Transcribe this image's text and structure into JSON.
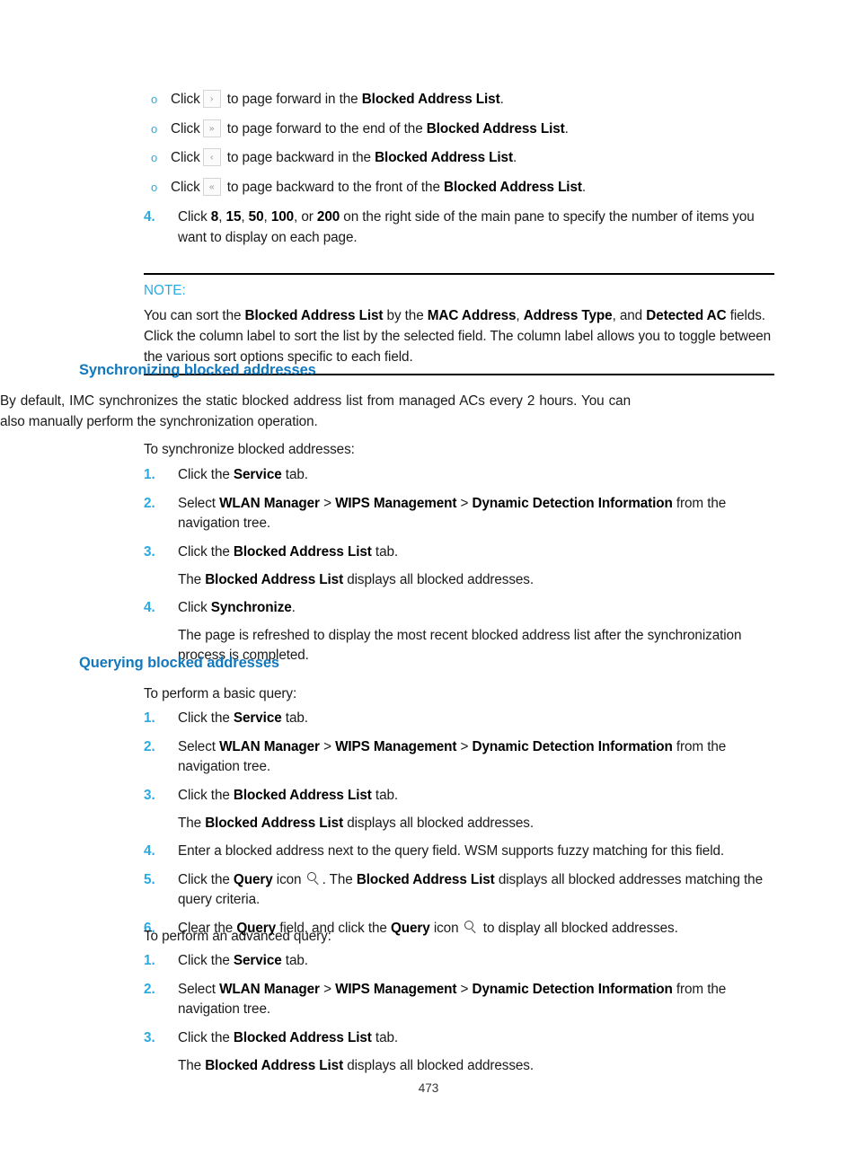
{
  "document": {
    "page_number": "473"
  },
  "paging_bullets": {
    "marker": "o",
    "items": [
      {
        "click": "Click",
        "icon_glyph": "›",
        "icon_name": "page-forward-icon",
        "text_before": " to page forward in the ",
        "bold_term": "Blocked Address List",
        "text_after": "."
      },
      {
        "click": "Click",
        "icon_glyph": "»",
        "icon_name": "page-last-icon",
        "text_before": " to page forward to the end of the ",
        "bold_term": "Blocked Address List",
        "text_after": "."
      },
      {
        "click": "Click",
        "icon_glyph": "‹",
        "icon_name": "page-backward-icon",
        "text_before": " to page backward in the ",
        "bold_term": "Blocked Address List",
        "text_after": "."
      },
      {
        "click": "Click",
        "icon_glyph": "«",
        "icon_name": "page-first-icon",
        "text_before": " to page backward to the front of the ",
        "bold_term": "Blocked Address List",
        "text_after": "."
      }
    ]
  },
  "step4_top": {
    "number": "4.",
    "prefix": "Click ",
    "values": [
      "8",
      "15",
      "50",
      "100",
      "200"
    ],
    "sep": ", ",
    "or": ", or ",
    "suffix": " on the right side of the main pane to specify the number of items you want to display on each page."
  },
  "note": {
    "title": "NOTE:",
    "line1_a": "You can sort the ",
    "line1_b": "Blocked Address List",
    "line1_c": " by the ",
    "line1_d": "MAC Address",
    "line1_e": ", ",
    "line1_f": "Address Type",
    "line1_g": ", and ",
    "line1_h": "Detected AC",
    "line1_i": " fields. Click the column label to sort the list by the selected field. The column label allows you to toggle between the various sort options specific to each field."
  },
  "sections": [
    {
      "heading": "Synchronizing blocked addresses",
      "intro": "By default, IMC synchronizes the static blocked address list from managed ACs every 2 hours. You can also manually perform the synchronization operation.",
      "lead": "To synchronize blocked addresses:"
    },
    {
      "heading": "Querying blocked addresses",
      "lead_basic": "To perform a basic query:",
      "lead_advanced": "To perform an advanced query:"
    }
  ],
  "common_steps": {
    "n1": "1.",
    "n2": "2.",
    "n3": "3.",
    "n4": "4.",
    "n5": "5.",
    "n6": "6.",
    "step1_a": "Click the ",
    "step1_b": "Service",
    "step1_c": " tab.",
    "step2_a": "Select ",
    "step2_b": "WLAN Manager",
    "step2_sep1": " > ",
    "step2_c": "WIPS Management",
    "step2_sep2": " > ",
    "step2_d": "Dynamic Detection Information",
    "step2_e": " from the navigation tree.",
    "step3_a": "Click the ",
    "step3_b": "Blocked Address List",
    "step3_c": " tab.",
    "step3_sub_a": "The ",
    "step3_sub_b": "Blocked Address List",
    "step3_sub_c": " displays all blocked addresses."
  },
  "sync_steps": {
    "step4_a": "Click ",
    "step4_b": "Synchronize",
    "step4_c": ".",
    "step4_sub": "The page is refreshed to display the most recent blocked address list after the synchronization process is completed."
  },
  "query_steps": {
    "step4": "Enter a blocked address next to the query field. WSM supports fuzzy matching for this field.",
    "step5_a": "Click the ",
    "step5_b": "Query",
    "step5_c": " icon ",
    "step5_d": ". The ",
    "step5_e": "Blocked Address List",
    "step5_f": " displays all blocked addresses matching the query criteria.",
    "step6_a": "Clear the ",
    "step6_b": "Query",
    "step6_c": " field, and click the ",
    "step6_d": "Query",
    "step6_e": " icon ",
    "step6_f": " to display all blocked addresses."
  },
  "colors": {
    "heading_blue": "#1278be",
    "accent_blue": "#29abe2",
    "body_text": "#1a1a1a"
  }
}
